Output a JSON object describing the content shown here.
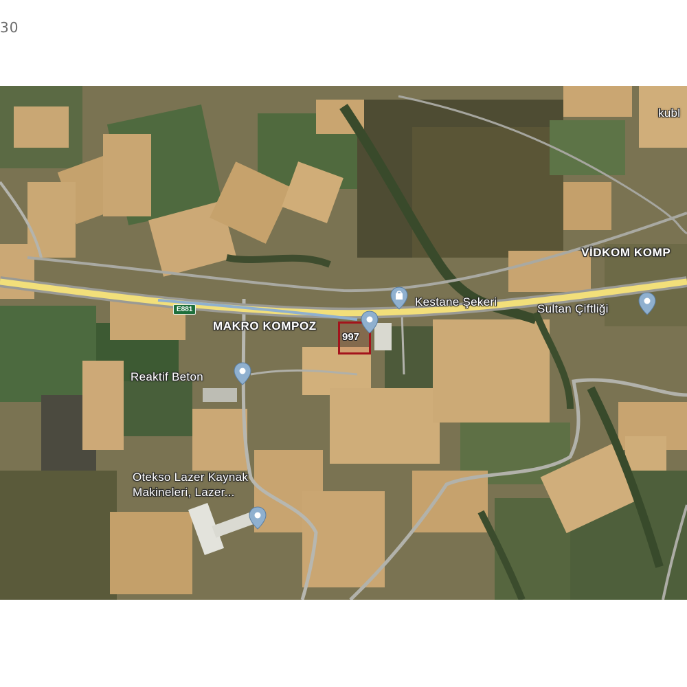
{
  "header": {
    "corner_text": "30"
  },
  "map": {
    "road_shield": "E881",
    "parcel_label": "997",
    "places": {
      "kubl": "kubl",
      "vidkom": "VİDKOM KOMP",
      "kestane": "Kestane Şekeri",
      "sultan": "Sultan Çiftliği",
      "makro": "MAKRO KOMPOZ",
      "reaktif": "Reaktif Beton",
      "otekso_line1": "Otekso Lazer Kaynak",
      "otekso_line2": "Makineleri, Lazer..."
    },
    "colors": {
      "pin": "#8fb0cf",
      "parcel_border": "#a3131b",
      "highway": "#f2df7a"
    },
    "icons": [
      "location-pin-icon",
      "shopping-bag-pin-icon"
    ]
  }
}
